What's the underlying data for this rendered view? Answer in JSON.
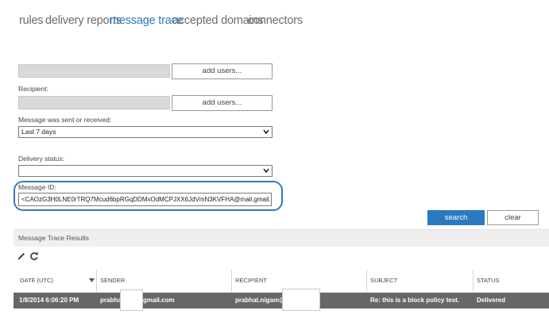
{
  "nav": {
    "tabs": [
      {
        "label": "rules"
      },
      {
        "label": "delivery reports"
      },
      {
        "label": "message trace",
        "active": true
      },
      {
        "label": "accepted domains"
      },
      {
        "label": "connectors"
      }
    ]
  },
  "form": {
    "sender_add_button": "add users...",
    "recipient_label": "Recipient:",
    "recipient_add_button": "add users...",
    "period_label": "Message was sent or received:",
    "period_value": "Last 7 days",
    "delivery_status_label": "Delivery status:",
    "delivery_status_value": "",
    "message_id_label": "Message ID:",
    "message_id_value": "<CAOzG3H0LNE0rTRQ7Mcud6bpRGqDDMxOdMCPJXX6JdVmN3KVFHA@mail.gmail.com>",
    "search_button": "search",
    "clear_button": "clear"
  },
  "results": {
    "title": "Message Trace Results",
    "toolbar": {
      "edit_icon": "pencil-icon",
      "refresh_icon": "refresh-icon"
    },
    "columns": [
      "DATE (UTC)",
      "SENDER",
      "RECIPIENT",
      "SUBJECT",
      "STATUS"
    ],
    "rows": [
      {
        "date": "1/8/2014 6:06:20 PM",
        "sender_prefix": "prabha",
        "sender_suffix": "gmail.com",
        "recipient_prefix": "prabhat.nigam@",
        "subject": "Re: this is a block policy test.",
        "status": "Delivered"
      }
    ]
  },
  "colors": {
    "accent": "#2a7ac0",
    "row_selected": "#676767",
    "highlight_ring": "#3b76b8"
  }
}
